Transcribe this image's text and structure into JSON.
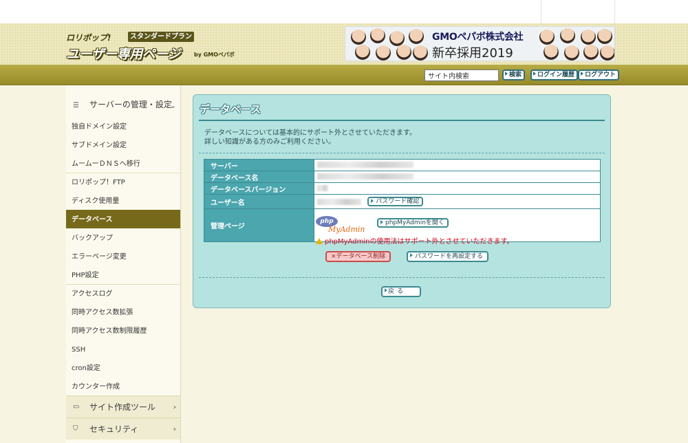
{
  "header": {
    "logo_top": "ロリポップ!",
    "plan_label": "スタンダードプラン",
    "logo_main": "ユーザー専用ページ",
    "logo_by": "by GMOペパボ",
    "banner": {
      "company": "GMOペパボ株式会社",
      "subtitle": "新卒採用2019"
    }
  },
  "navbar": {
    "search_value": "サイト内検索",
    "search_button": "検索",
    "login_history_button": "ログイン履歴",
    "logout_button": "ログアウト"
  },
  "sidebar": {
    "server_group": "サーバーの管理・設定",
    "items": [
      "独自ドメイン設定",
      "サブドメイン設定",
      "ムームーＤＮＳへ移行",
      "ロリポップ！FTP",
      "ディスク使用量",
      "データベース",
      "バックアップ",
      "エラーページ変更",
      "PHP設定",
      "アクセスログ",
      "同時アクセス数拡張",
      "同時アクセス数制限履歴",
      "SSH",
      "cron設定",
      "カウンター作成"
    ],
    "site_tools_group": "サイト作成ツール",
    "security_group": "セキュリティ"
  },
  "panel": {
    "title": "データベース",
    "intro_line1": "データベースについては基本的にサポート外とさせていただきます。",
    "intro_line2": "詳しい知識がある方のみご利用ください。",
    "labels": {
      "server": "サーバー",
      "db_name": "データベース名",
      "db_version": "データベースバージョン",
      "user": "ユーザー名",
      "admin": "管理ページ"
    },
    "password_check_button": "パスワード確認",
    "pma_logo_php": "php",
    "pma_logo_myadmin": "MyAdmin",
    "pma_open_button": "phpMyAdminを開く",
    "pma_warning": "phpMyAdminの使用法はサポート外とさせていただきます。",
    "delete_button": "×データベース削除",
    "reset_password_button": "パスワードを再設定する",
    "back_button": "戻る"
  },
  "colors": {
    "panel_bg": "#b5e3e0",
    "table_header": "#4ba6ae",
    "sidebar_active": "#76691a",
    "navbar": "#a89b35",
    "warning": "#d0021b"
  }
}
